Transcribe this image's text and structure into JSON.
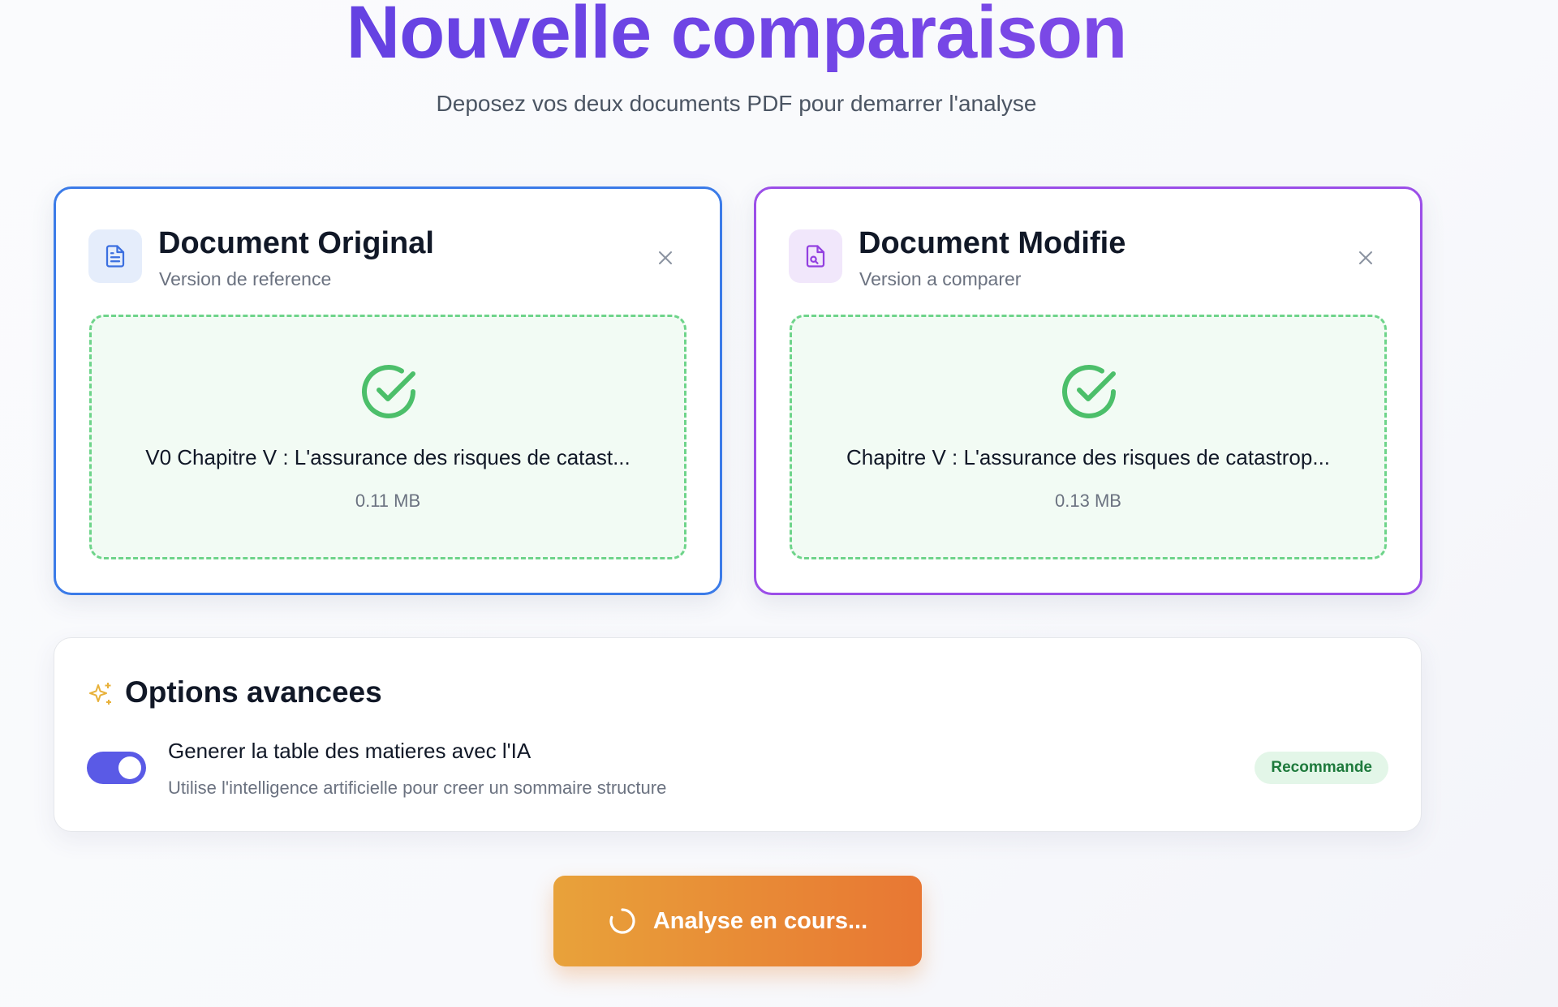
{
  "header": {
    "title": "Nouvelle comparaison",
    "subtitle": "Deposez vos deux documents PDF pour demarrer l'analyse"
  },
  "documents": {
    "original": {
      "title": "Document Original",
      "subtitle": "Version de reference",
      "icon": "file-text-icon",
      "file_name": "V0 Chapitre V : L'assurance des risques de catast...",
      "file_size": "0.11 MB",
      "accent": "#3b7be8"
    },
    "modified": {
      "title": "Document Modifie",
      "subtitle": "Version a comparer",
      "icon": "file-search-icon",
      "file_name": "Chapitre V : L'assurance des risques de catastrop...",
      "file_size": "0.13 MB",
      "accent": "#9b4ee8"
    }
  },
  "options": {
    "title": "Options avancees",
    "icon": "sparkles-icon",
    "ai_toc": {
      "label": "Generer la table des matieres avec l'IA",
      "description": "Utilise l'intelligence artificielle pour creer un sommaire structure",
      "enabled": true,
      "badge": "Recommande"
    }
  },
  "action": {
    "label": "Analyse en cours...",
    "icon": "spinner-icon",
    "state": "loading"
  },
  "colors": {
    "title_gradient_start": "#5b3fe0",
    "title_gradient_end": "#8b4fe8",
    "success": "#4cbf6a",
    "toggle_on": "#5a5ae6",
    "button_gradient_start": "#e8a23a",
    "button_gradient_end": "#e87733"
  }
}
